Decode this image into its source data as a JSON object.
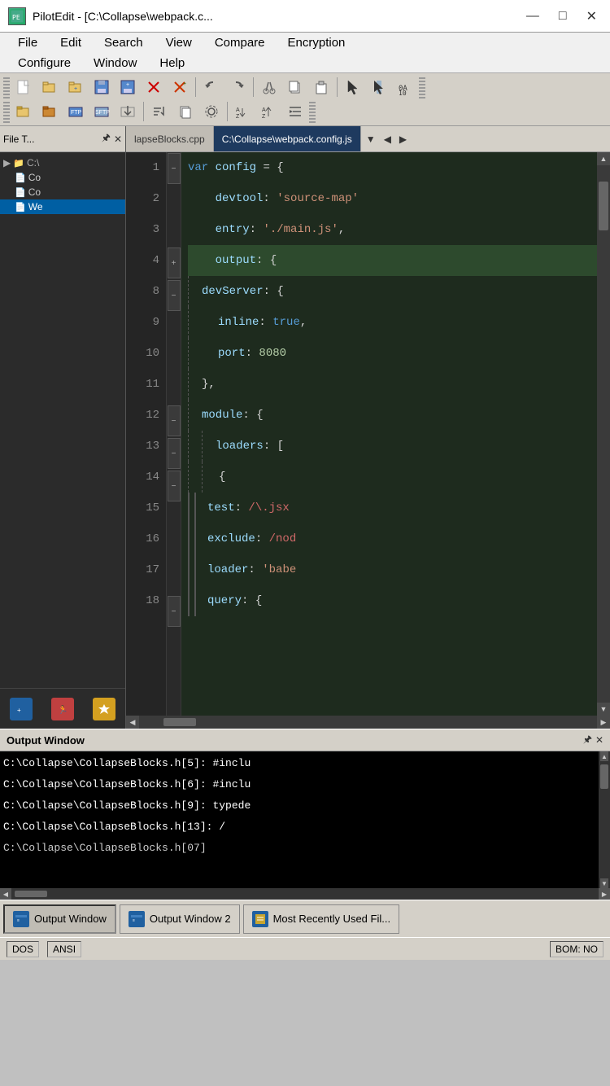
{
  "titleBar": {
    "icon": "PE",
    "title": "PilotEdit - [C:\\Collapse\\webpack.c...",
    "minimize": "—",
    "maximize": "□",
    "close": "✕"
  },
  "menuBar": {
    "row1": [
      "File",
      "Edit",
      "Search",
      "View",
      "Compare",
      "Encryption"
    ],
    "row2": [
      "Configure",
      "Window",
      "Help"
    ]
  },
  "tabs": {
    "tab1": "lapseBlocks.cpp",
    "tab2": "C:\\Collapse\\webpack.config.js",
    "nav_prev": "◀",
    "nav_next": "▶",
    "nav_list": "▼"
  },
  "fileTree": {
    "title": "File T...",
    "pin": "🖈",
    "close": "✕",
    "items": [
      {
        "label": "C:\\",
        "type": "root",
        "indent": 0
      },
      {
        "label": "Co",
        "type": "file",
        "indent": 1
      },
      {
        "label": "Co",
        "type": "file",
        "indent": 1
      },
      {
        "label": "We",
        "type": "file-blue",
        "indent": 1
      }
    ]
  },
  "codeEditor": {
    "lines": [
      {
        "num": 1,
        "fold": "-",
        "code": "var config = {",
        "highlight": false
      },
      {
        "num": 2,
        "fold": "",
        "code": "    devtool: 'source-map'",
        "highlight": false
      },
      {
        "num": 3,
        "fold": "",
        "code": "    entry: './main.js',",
        "highlight": false
      },
      {
        "num": 4,
        "fold": "+",
        "code": "    output: {",
        "highlight": true
      },
      {
        "num": 8,
        "fold": "-",
        "code": "    devServer: {",
        "highlight": false
      },
      {
        "num": 9,
        "fold": "",
        "code": "        inline: true,",
        "highlight": false
      },
      {
        "num": 10,
        "fold": "",
        "code": "        port: 8080",
        "highlight": false
      },
      {
        "num": 11,
        "fold": "",
        "code": "    },",
        "highlight": false
      },
      {
        "num": 12,
        "fold": "-",
        "code": "    module: {",
        "highlight": false
      },
      {
        "num": 13,
        "fold": "-",
        "code": "        loaders: [",
        "highlight": false
      },
      {
        "num": 14,
        "fold": "-",
        "code": "            {",
        "highlight": false
      },
      {
        "num": 15,
        "fold": "",
        "code": "                test: /\\.jsx",
        "highlight": false
      },
      {
        "num": 16,
        "fold": "",
        "code": "                exclude: /nod",
        "highlight": false
      },
      {
        "num": 17,
        "fold": "",
        "code": "                loader: 'babe",
        "highlight": false
      },
      {
        "num": 18,
        "fold": "-",
        "code": "                query: {",
        "highlight": false
      }
    ]
  },
  "outputWindow": {
    "title": "Output Window",
    "pin": "🖈",
    "close": "✕",
    "lines": [
      "C:\\Collapse\\CollapseBlocks.h[5]: #inclu",
      "C:\\Collapse\\CollapseBlocks.h[6]: #inclu",
      "C:\\Collapse\\CollapseBlocks.h[9]: typede",
      "C:\\Collapse\\CollapseBlocks.h[13]:   /",
      "C:\\Collapse\\CollapseBlocks.h[07]"
    ]
  },
  "taskbar": {
    "btn1": "Output Window",
    "btn2": "Output Window 2",
    "btn3": "Most Recently Used Fil..."
  },
  "statusBar": {
    "item1": "DOS",
    "item2": "ANSI",
    "item3": "BOM: NO"
  }
}
